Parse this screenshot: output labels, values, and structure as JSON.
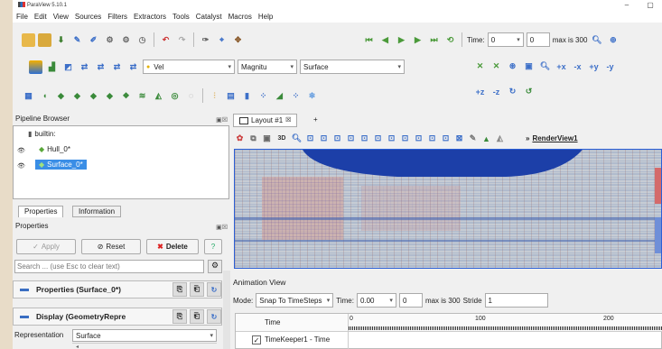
{
  "window": {
    "title": "ParaView 5.10.1",
    "minimize": "–",
    "maximize": "▢"
  },
  "menu": [
    "File",
    "Edit",
    "View",
    "Sources",
    "Filters",
    "Extractors",
    "Tools",
    "Catalyst",
    "Macros",
    "Help"
  ],
  "time_toolbar": {
    "time_label": "Time:",
    "time_value": "0",
    "index_value": "0",
    "max_label": "max is 300"
  },
  "color_toolbar": {
    "array": "Vel",
    "component": "Magnitu",
    "representation": "Surface"
  },
  "pipeline": {
    "title": "Pipeline Browser",
    "items": [
      "builtin:",
      "Hull_0*",
      "Surface_0*"
    ]
  },
  "props_tabs": [
    "Properties",
    "Information"
  ],
  "properties": {
    "title": "Properties",
    "apply": "Apply",
    "reset": "Reset",
    "delete": "Delete",
    "help": "?",
    "search_placeholder": "Search ... (use Esc to clear text)",
    "section1": "Properties (Surface_0*)",
    "section2": "Display (GeometryRepre",
    "representation_label": "Representation",
    "representation_value": "Surface"
  },
  "layout": {
    "tab": "Layout #1",
    "add": "+",
    "view_name": "RenderView1",
    "mode_3d": "3D"
  },
  "animation": {
    "title": "Animation View",
    "mode_label": "Mode:",
    "mode_value": "Snap To TimeSteps",
    "time_label": "Time:",
    "time_value": "0.00",
    "index_value": "0",
    "max_label": "max is 300",
    "stride_label": "Stride",
    "stride_value": "1",
    "col_time": "Time",
    "ticks": [
      "0",
      "100",
      "200"
    ],
    "row1": "TimeKeeper1 - Time"
  },
  "colors": {
    "accent": "#2b5fd6",
    "selection": "#3a8ee6"
  }
}
